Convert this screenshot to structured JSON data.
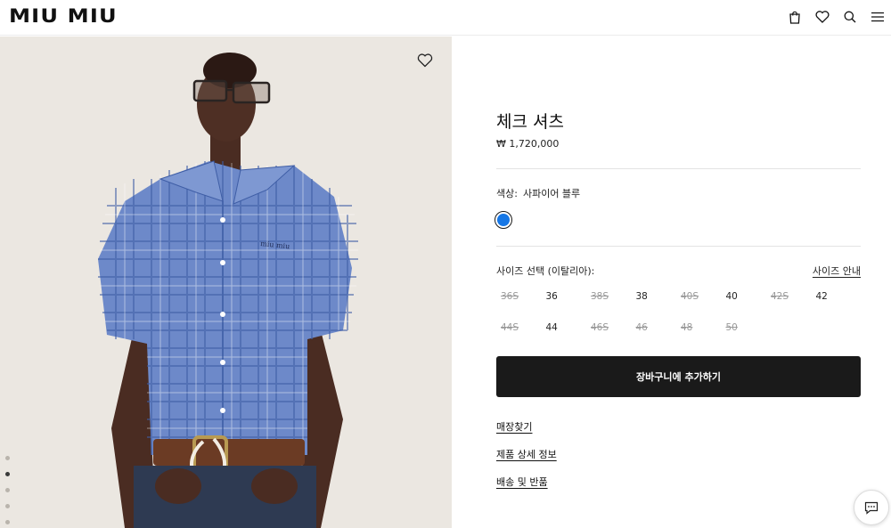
{
  "header": {
    "logo": "MIU MIU",
    "icons": [
      "bag-icon",
      "heart-icon",
      "search-icon",
      "menu-icon"
    ]
  },
  "gallery": {
    "image_alt": "model wearing blue check shirt",
    "wishlist_icon": "heart-outline-icon",
    "slide_count": 5,
    "active_slide": 2
  },
  "product": {
    "title": "체크 셔츠",
    "price": "₩ 1,720,000",
    "color_label": "색상:",
    "color_value": "사파이어 블루",
    "swatch_color": "#1677e6",
    "size_label": "사이즈 선택 (이탈리아):",
    "size_guide": "사이즈 안내",
    "sizes": [
      {
        "label": "36S",
        "available": false
      },
      {
        "label": "36",
        "available": true
      },
      {
        "label": "38S",
        "available": false
      },
      {
        "label": "38",
        "available": true
      },
      {
        "label": "40S",
        "available": false
      },
      {
        "label": "40",
        "available": true
      },
      {
        "label": "42S",
        "available": false
      },
      {
        "label": "42",
        "available": true
      },
      {
        "label": "44S",
        "available": false
      },
      {
        "label": "44",
        "available": true
      },
      {
        "label": "46S",
        "available": false
      },
      {
        "label": "46",
        "available": false
      },
      {
        "label": "48",
        "available": false
      },
      {
        "label": "50",
        "available": false
      }
    ],
    "add_to_cart": "장바구니에 추가하기",
    "links": {
      "store_finder": "매장찾기",
      "details": "제품 상세 정보",
      "shipping": "배송 및 반품"
    }
  },
  "chat_icon": "chat-icon"
}
